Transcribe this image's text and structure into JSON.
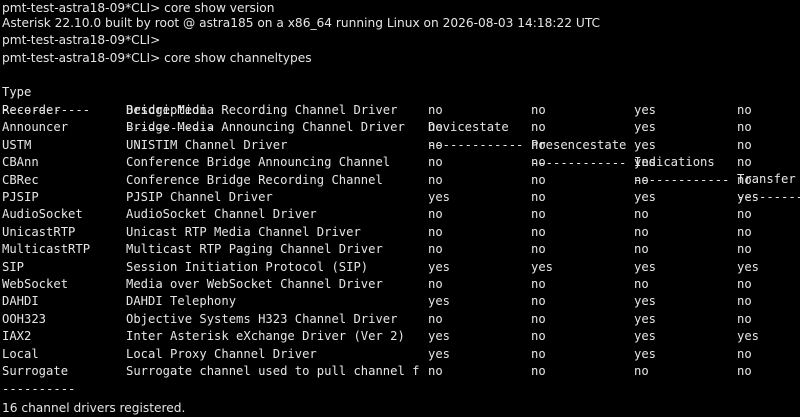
{
  "terminal": {
    "lines": {
      "prompt1": "pmt-test-astra18-09*CLI> core show version",
      "version": "Asterisk 22.10.0 built by root @ astra185 on a x86_64 running Linux on 2026-08-03 14:18:22 UTC",
      "prompt2": "pmt-test-astra18-09*CLI>",
      "prompt3": "pmt-test-astra18-09*CLI> core show channeltypes"
    },
    "headers": {
      "type": "Type",
      "description": "Description",
      "devicestate": "Devicestate",
      "presencestate": "Presencestate",
      "indications": "Indications",
      "transfer": "Transfer"
    },
    "separators": {
      "type": "------------",
      "description": "------------",
      "devicestate": "-------------",
      "presencestate": "-------------",
      "indications": "-------------",
      "transfer": "---------"
    },
    "rows": [
      {
        "type": "Recorder",
        "description": "Bridge Media Recording Channel Driver",
        "devicestate": "no",
        "presencestate": "no",
        "indications": "yes",
        "transfer": "no"
      },
      {
        "type": "Announcer",
        "description": "Bridge Media Announcing Channel Driver",
        "devicestate": "no",
        "presencestate": "no",
        "indications": "yes",
        "transfer": "no"
      },
      {
        "type": "USTM",
        "description": "UNISTIM Channel Driver",
        "devicestate": "no",
        "presencestate": "no",
        "indications": "yes",
        "transfer": "no"
      },
      {
        "type": "CBAnn",
        "description": "Conference Bridge Announcing Channel",
        "devicestate": "no",
        "presencestate": "no",
        "indications": "yes",
        "transfer": "no"
      },
      {
        "type": "CBRec",
        "description": "Conference Bridge Recording Channel",
        "devicestate": "no",
        "presencestate": "no",
        "indications": "no",
        "transfer": "no"
      },
      {
        "type": "PJSIP",
        "description": "PJSIP Channel Driver",
        "devicestate": "yes",
        "presencestate": "no",
        "indications": "yes",
        "transfer": "yes"
      },
      {
        "type": "AudioSocket",
        "description": "AudioSocket Channel Driver",
        "devicestate": "no",
        "presencestate": "no",
        "indications": "no",
        "transfer": "no"
      },
      {
        "type": "UnicastRTP",
        "description": "Unicast RTP Media Channel Driver",
        "devicestate": "no",
        "presencestate": "no",
        "indications": "no",
        "transfer": "no"
      },
      {
        "type": "MulticastRTP",
        "description": "Multicast RTP Paging Channel Driver",
        "devicestate": "no",
        "presencestate": "no",
        "indications": "no",
        "transfer": "no"
      },
      {
        "type": "SIP",
        "description": "Session Initiation Protocol (SIP)",
        "devicestate": "yes",
        "presencestate": "yes",
        "indications": "yes",
        "transfer": "yes"
      },
      {
        "type": "WebSocket",
        "description": "Media over WebSocket Channel Driver",
        "devicestate": "no",
        "presencestate": "no",
        "indications": "no",
        "transfer": "no"
      },
      {
        "type": "DAHDI",
        "description": "DAHDI Telephony",
        "devicestate": "yes",
        "presencestate": "no",
        "indications": "yes",
        "transfer": "no"
      },
      {
        "type": "OOH323",
        "description": "Objective Systems H323 Channel Driver",
        "devicestate": "no",
        "presencestate": "no",
        "indications": "yes",
        "transfer": "no"
      },
      {
        "type": "IAX2",
        "description": "Inter Asterisk eXchange Driver (Ver 2)",
        "devicestate": "yes",
        "presencestate": "no",
        "indications": "yes",
        "transfer": "yes"
      },
      {
        "type": "Local",
        "description": "Local Proxy Channel Driver",
        "devicestate": "yes",
        "presencestate": "no",
        "indications": "yes",
        "transfer": "no"
      },
      {
        "type": "Surrogate",
        "description": "Surrogate channel used to pull channel f",
        "devicestate": "no",
        "presencestate": "no",
        "indications": "no",
        "transfer": "no"
      }
    ],
    "footer_separator": "----------",
    "summary": "16 channel drivers registered."
  }
}
